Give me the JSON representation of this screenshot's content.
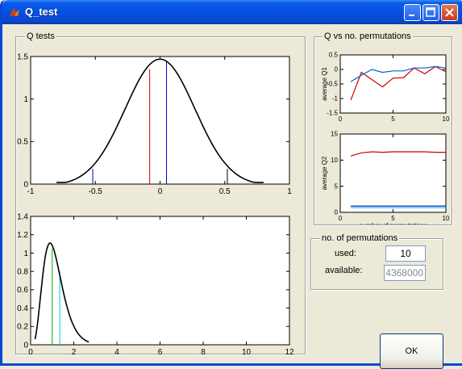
{
  "window": {
    "title": "Q_test",
    "minimize_icon": "minimize-icon",
    "maximize_icon": "maximize-icon",
    "close_icon": "close-icon",
    "app_icon": "matlab-icon"
  },
  "panels": {
    "q_tests": {
      "label": "Q tests"
    },
    "q_vs_perm": {
      "label": "Q vs no. permutations"
    },
    "perm": {
      "label": "no. of permutations",
      "used_label": "used:",
      "available_label": "available:",
      "used_value": "10",
      "available_value": "4368000"
    }
  },
  "ok_button": {
    "label": "OK"
  },
  "colors": {
    "black": "#000000",
    "red": "#cc0000",
    "blue": "#0000cc",
    "green": "#00b000",
    "cyan": "#00c8d8"
  },
  "chart_data": [
    {
      "type": "line",
      "title": "",
      "xlim": [
        -1,
        1
      ],
      "ylim": [
        0,
        1.5
      ],
      "xticks": [
        "-1",
        "-0.5",
        "0",
        "0.5",
        "1"
      ],
      "yticks": [
        "0",
        "0.5",
        "1",
        "1.5"
      ],
      "series": [
        {
          "color": "#000000",
          "distribution": "gaussian",
          "mean": 0,
          "sd": 0.27,
          "peak": 1.49,
          "x_range": [
            -0.8,
            0.8
          ]
        }
      ],
      "vlines": [
        {
          "x": -0.52,
          "height": 0.18,
          "color": "#0000cc"
        },
        {
          "x": -0.08,
          "height": 1.35,
          "color": "#cc0000"
        },
        {
          "x": 0.05,
          "height": 1.45,
          "color": "#0000cc"
        },
        {
          "x": 0.52,
          "height": 0.18,
          "color": "#000000"
        }
      ]
    },
    {
      "type": "line",
      "title": "",
      "xlim": [
        0,
        12
      ],
      "ylim": [
        0,
        1.4
      ],
      "xticks": [
        "0",
        "2",
        "4",
        "6",
        "8",
        "10",
        "12"
      ],
      "yticks": [
        "0",
        "0.2",
        "0.4",
        "0.6",
        "0.8",
        "1",
        "1.2",
        "1.4"
      ],
      "series": [
        {
          "color": "#000000",
          "distribution": "chi-like",
          "mode": 0.9,
          "peak": 1.11,
          "x_range": [
            0.2,
            2.7
          ]
        }
      ],
      "vlines": [
        {
          "x": 1.0,
          "height": 1.05,
          "color": "#00b000"
        },
        {
          "x": 1.35,
          "height": 0.8,
          "color": "#00c8d8"
        }
      ]
    },
    {
      "type": "line",
      "title": "",
      "ylabel": "average Q1",
      "xlim": [
        0,
        10
      ],
      "ylim": [
        -1.5,
        0.5
      ],
      "xticks": [
        "0",
        "5",
        "10"
      ],
      "yticks": [
        "-1.5",
        "-1",
        "-0.5",
        "0",
        "0.5"
      ],
      "series": [
        {
          "color": "#cc0000",
          "x": [
            1,
            2,
            3,
            4,
            5,
            6,
            7,
            8,
            9,
            10
          ],
          "y": [
            -1.05,
            -0.1,
            -0.35,
            -0.6,
            -0.3,
            -0.28,
            0.05,
            -0.15,
            0.1,
            -0.08
          ]
        },
        {
          "color": "#0066cc",
          "x": [
            1,
            2,
            3,
            4,
            5,
            6,
            7,
            8,
            9,
            10
          ],
          "y": [
            -0.42,
            -0.2,
            0.0,
            -0.1,
            -0.05,
            -0.05,
            0.05,
            0.05,
            0.1,
            0.05
          ]
        }
      ]
    },
    {
      "type": "line",
      "title": "",
      "xlabel": "number of permutations",
      "ylabel": "average Q2",
      "xlim": [
        0,
        10
      ],
      "ylim": [
        0,
        15
      ],
      "xticks": [
        "0",
        "5",
        "10"
      ],
      "yticks": [
        "0",
        "5",
        "10",
        "15"
      ],
      "series": [
        {
          "color": "#cc0000",
          "x": [
            1,
            2,
            3,
            4,
            5,
            6,
            7,
            8,
            9,
            10
          ],
          "y": [
            10.8,
            11.4,
            11.6,
            11.5,
            11.6,
            11.6,
            11.6,
            11.6,
            11.5,
            11.5
          ]
        },
        {
          "color": "#0000cc",
          "x": [
            1,
            2,
            3,
            4,
            5,
            6,
            7,
            8,
            9,
            10
          ],
          "y": [
            1.2,
            1.2,
            1.2,
            1.2,
            1.2,
            1.2,
            1.2,
            1.2,
            1.2,
            1.2
          ]
        },
        {
          "color": "#00c8d8",
          "x": [
            1,
            2,
            3,
            4,
            5,
            6,
            7,
            8,
            9,
            10
          ],
          "y": [
            0.9,
            0.9,
            0.9,
            0.9,
            0.9,
            0.9,
            0.9,
            0.9,
            0.9,
            0.9
          ]
        }
      ]
    }
  ]
}
